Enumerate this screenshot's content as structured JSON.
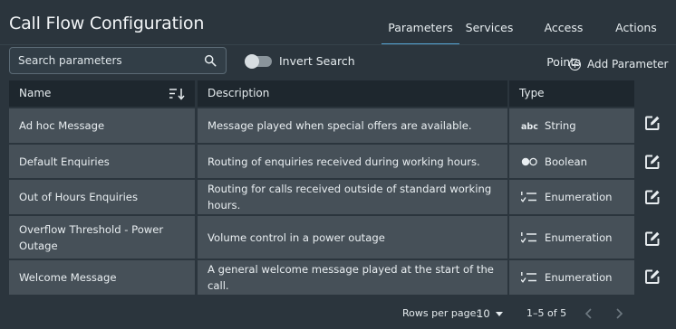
{
  "page": {
    "title": "Call Flow Configuration"
  },
  "tabs": [
    {
      "label": "Parameters",
      "active": true
    },
    {
      "label": "Services"
    },
    {
      "label": "Access Points"
    },
    {
      "label": "Actions"
    }
  ],
  "search": {
    "placeholder": "Search parameters",
    "value": ""
  },
  "invert_search": {
    "label": "Invert Search",
    "on": false
  },
  "add_parameter": {
    "label": "Add Parameter"
  },
  "table": {
    "headers": {
      "name": "Name",
      "description": "Description",
      "type": "Type"
    },
    "rows": [
      {
        "name": "Ad hoc Message",
        "description": "Message played when special offers are available.",
        "type": "String",
        "type_icon": "abc-icon"
      },
      {
        "name": "Default Enquiries",
        "description": "Routing of enquiries received during working hours.",
        "type": "Boolean",
        "type_icon": "toggle-dots-icon"
      },
      {
        "name": "Out of Hours Enquiries",
        "description": "Routing for calls received outside of standard working hours.",
        "type": "Enumeration",
        "type_icon": "checklist-icon"
      },
      {
        "name": "Overflow Threshold - Power Outage",
        "description": "Volume control in a power outage",
        "type": "Enumeration",
        "type_icon": "checklist-icon"
      },
      {
        "name": "Welcome Message",
        "description": "A general welcome message played at the start of the call.",
        "type": "Enumeration",
        "type_icon": "checklist-icon"
      }
    ]
  },
  "pagination": {
    "rows_per_page_label": "Rows per page:",
    "rows_per_page": "10",
    "range": "1–5 of 5"
  },
  "colors": {
    "background": "#2b353d",
    "header": "#1e272e",
    "cell": "#465058",
    "accent": "#56a6d6"
  }
}
